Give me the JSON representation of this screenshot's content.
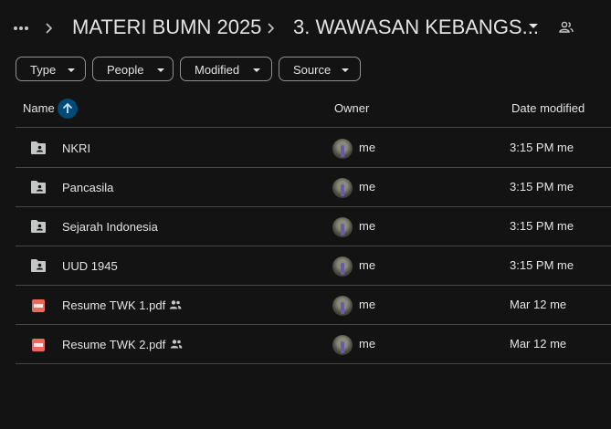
{
  "breadcrumb": {
    "parent": "MATERI BUMN 2025",
    "current": "3. WAWASAN KEBANGS..."
  },
  "filters": [
    {
      "label": "Type"
    },
    {
      "label": "People"
    },
    {
      "label": "Modified"
    },
    {
      "label": "Source"
    }
  ],
  "columns": {
    "name": "Name",
    "owner": "Owner",
    "date": "Date modified"
  },
  "files": [
    {
      "name": "NKRI",
      "type": "shared-folder",
      "owner": "me",
      "date": "3:15 PM me",
      "shared": false
    },
    {
      "name": "Pancasila",
      "type": "shared-folder",
      "owner": "me",
      "date": "3:15 PM me",
      "shared": false
    },
    {
      "name": "Sejarah Indonesia",
      "type": "shared-folder",
      "owner": "me",
      "date": "3:15 PM me",
      "shared": false
    },
    {
      "name": "UUD 1945",
      "type": "shared-folder",
      "owner": "me",
      "date": "3:15 PM me",
      "shared": false
    },
    {
      "name": "Resume TWK 1.pdf",
      "type": "pdf",
      "owner": "me",
      "date": "Mar 12 me",
      "shared": true
    },
    {
      "name": "Resume TWK 2.pdf",
      "type": "pdf",
      "owner": "me",
      "date": "Mar 12 me",
      "shared": true
    }
  ],
  "icons": {
    "more": "more-horiz-icon",
    "separator": "chevron-right-icon",
    "dropdown": "arrow-drop-down-icon",
    "people": "people-icon",
    "sort": "arrow-upward-icon",
    "folder": "shared-folder-icon",
    "pdf": "pdf-icon"
  },
  "colors": {
    "background": "#131313",
    "text": "#e3e3e3",
    "sort_accent": "#004a77",
    "pdf_red": "#ee675c"
  }
}
